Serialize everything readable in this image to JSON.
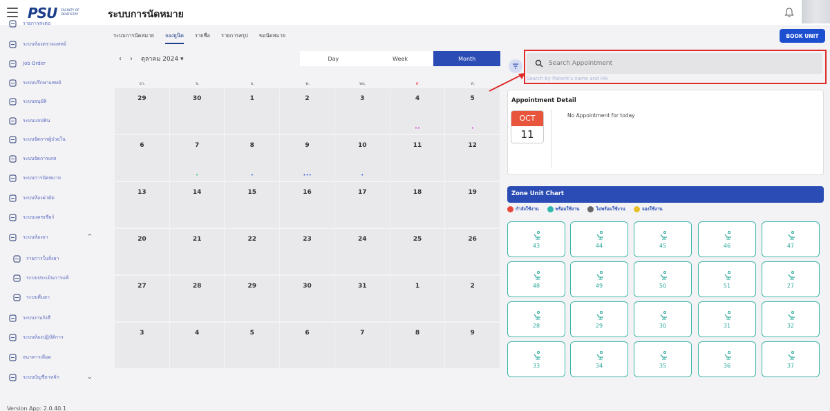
{
  "header": {
    "app_title": "ระบบการนัดหมาย",
    "logo_text": "PSU",
    "logo_sub": "FACULTY OF DENTISTRY"
  },
  "sidebar": {
    "items": [
      {
        "label": "รายการส่งต่อ",
        "icon": "walking-person-icon"
      },
      {
        "label": "ระบบห้องตรวจแพทย์",
        "icon": "stethoscope-icon"
      },
      {
        "label": "Job Order",
        "icon": "job-order-icon"
      },
      {
        "label": "ระบบปรึกษาแพทย์",
        "icon": "consult-icon"
      },
      {
        "label": "ระบบอนุมัติ",
        "icon": "approve-shield-icon"
      },
      {
        "label": "ระบบแลปฟัน",
        "icon": "lab-icon"
      },
      {
        "label": "ระบบจัดการผู้ป่วยใน",
        "icon": "inpatient-icon"
      },
      {
        "label": "ระบบจัดการเคส",
        "icon": "case-icon"
      },
      {
        "label": "ระบบการนัดหมาย",
        "icon": "calendar-icon"
      },
      {
        "label": "ระบบห้องผ่าตัด",
        "icon": "scalpel-icon"
      },
      {
        "label": "ระบบแคชเชียร์",
        "icon": "cashier-icon"
      },
      {
        "label": "ระบบห้องยา",
        "icon": "pharmacy-icon",
        "expanded": true
      },
      {
        "label": "รายการใบสั่งยา",
        "icon": "prescription-icon",
        "sub": true
      },
      {
        "label": "ระบบประเมินการแพ้",
        "icon": "allergy-icon",
        "sub": true
      },
      {
        "label": "ระบบคืนยา",
        "icon": "return-medicine-icon",
        "sub": true
      },
      {
        "label": "ระบบงานรังสี",
        "icon": "radiology-icon"
      },
      {
        "label": "ระบบห้องปฏิบัติการ",
        "icon": "laboratory-flask-icon"
      },
      {
        "label": "ธนาคารเลือด",
        "icon": "blood-bank-icon"
      },
      {
        "label": "ระบบบัญชียาหลัก",
        "icon": "drug-list-icon"
      }
    ],
    "version": "Version App: 2.0.40.1"
  },
  "tabs": [
    "ระบบการนัดหมาย",
    "จองยูนิต",
    "รายชื่อ",
    "รายการสรุป",
    "ขอนัดหมาย"
  ],
  "active_tab": "จองยูนิต",
  "book_unit_label": "BOOK UNIT",
  "view_modes": [
    "Day",
    "Week",
    "Month"
  ],
  "active_view": "Month",
  "calendar": {
    "month_label": "ตุลาคม 2024",
    "weekdays": [
      "อา.",
      "จ.",
      "อ.",
      "พ.",
      "พฤ.",
      "ศ.",
      "ส."
    ],
    "weeks": [
      [
        {
          "d": "29"
        },
        {
          "d": "30"
        },
        {
          "d": "1"
        },
        {
          "d": "2"
        },
        {
          "d": "3"
        },
        {
          "d": "4",
          "dots": "••",
          "dot_color": "#d23fd2"
        },
        {
          "d": "5",
          "dots": "•",
          "dot_color": "#d23fd2"
        }
      ],
      [
        {
          "d": "6"
        },
        {
          "d": "7",
          "dots": "•",
          "dot_color": "#33c26a"
        },
        {
          "d": "8",
          "dots": "•",
          "dot_color": "#3a5fd6"
        },
        {
          "d": "9",
          "dots": "•••",
          "dot_color": "#3a5fd6"
        },
        {
          "d": "10",
          "dots": "•",
          "dot_color": "#3a5fd6"
        },
        {
          "d": "11"
        },
        {
          "d": "12"
        }
      ],
      [
        {
          "d": "13"
        },
        {
          "d": "14"
        },
        {
          "d": "15"
        },
        {
          "d": "16"
        },
        {
          "d": "17"
        },
        {
          "d": "18"
        },
        {
          "d": "19"
        }
      ],
      [
        {
          "d": "20"
        },
        {
          "d": "21"
        },
        {
          "d": "22"
        },
        {
          "d": "23"
        },
        {
          "d": "24"
        },
        {
          "d": "25"
        },
        {
          "d": "26"
        }
      ],
      [
        {
          "d": "27"
        },
        {
          "d": "28"
        },
        {
          "d": "29"
        },
        {
          "d": "30"
        },
        {
          "d": "31"
        },
        {
          "d": "1"
        },
        {
          "d": "2"
        }
      ],
      [
        {
          "d": "3"
        },
        {
          "d": "4"
        },
        {
          "d": "5"
        },
        {
          "d": "6"
        },
        {
          "d": "7"
        },
        {
          "d": "8"
        },
        {
          "d": "9"
        }
      ]
    ]
  },
  "search": {
    "placeholder": "Search Appointment",
    "hint": "Search by Patient's name and HN"
  },
  "appointment_detail": {
    "title": "Appointment Detail",
    "month": "OCT",
    "day": "11",
    "message": "No Appointment for today"
  },
  "zone_chart": {
    "title": "Zone Unit Chart",
    "legend": [
      {
        "label": "กำลังใช้งาน",
        "color": "#e8483c"
      },
      {
        "label": "พร้อมใช้งาน",
        "color": "#2fb7ad"
      },
      {
        "label": "ไม่พร้อมใช้งาน",
        "color": "#666666"
      },
      {
        "label": "จองใช้งาน",
        "color": "#e6c02a"
      }
    ],
    "units": [
      "43",
      "44",
      "45",
      "46",
      "47",
      "48",
      "49",
      "50",
      "51",
      "27",
      "28",
      "29",
      "30",
      "31",
      "32",
      "33",
      "34",
      "35",
      "36",
      "37"
    ]
  }
}
